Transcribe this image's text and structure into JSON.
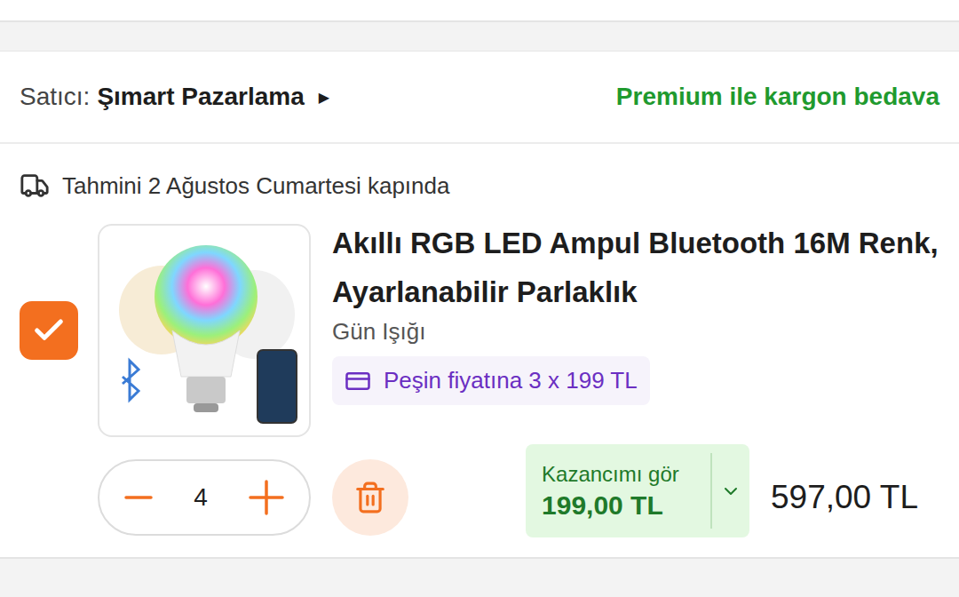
{
  "seller": {
    "label": "Satıcı:",
    "name": "Şımart Pazarlama",
    "arrow": "▶"
  },
  "shipping_promo": "Premium ile kargon bedava",
  "delivery": "Tahmini 2 Ağustos Cumartesi kapında",
  "item": {
    "checked": true,
    "title": "Akıllı RGB LED Ampul Bluetooth 16M Renk, Ayarlanabilir Parlaklık",
    "variant": "Gün Işığı",
    "installment": "Peşin fiyatına 3 x 199 TL",
    "quantity": "4",
    "savings": {
      "label": "Kazancımı gör",
      "amount": "199,00 TL",
      "expanded": false
    },
    "price": "597,00 TL"
  }
}
